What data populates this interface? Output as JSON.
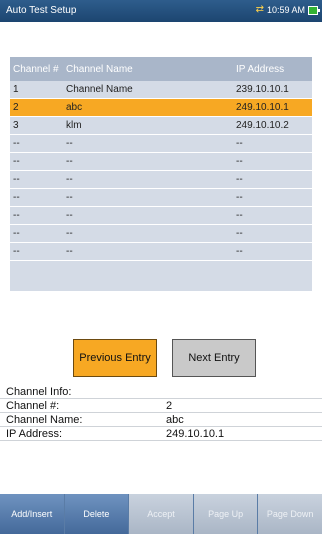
{
  "titlebar": {
    "title": "Auto Test Setup",
    "time": "10:59 AM",
    "icons": [
      "sync-icon",
      "battery-icon"
    ]
  },
  "table": {
    "headers": [
      "Channel #",
      "Channel Name",
      "IP Address"
    ],
    "rows": [
      {
        "channel": "1",
        "name": "Channel Name",
        "ip": "239.10.10.1"
      },
      {
        "channel": "2",
        "name": "abc",
        "ip": "249.10.10.1"
      },
      {
        "channel": "3",
        "name": "klm",
        "ip": "249.10.10.2"
      },
      {
        "channel": "--",
        "name": "--",
        "ip": "--"
      },
      {
        "channel": "--",
        "name": "--",
        "ip": "--"
      },
      {
        "channel": "--",
        "name": "--",
        "ip": "--"
      },
      {
        "channel": "--",
        "name": "--",
        "ip": "--"
      },
      {
        "channel": "--",
        "name": "--",
        "ip": "--"
      },
      {
        "channel": "--",
        "name": "--",
        "ip": "--"
      },
      {
        "channel": "--",
        "name": "--",
        "ip": "--"
      }
    ],
    "selected_row": 2
  },
  "nav": {
    "previous_label": "Previous Entry",
    "next_label": "Next Entry"
  },
  "channel_info": {
    "header": "Channel Info:",
    "channel_label": "Channel #:",
    "channel_value": "2",
    "name_label": "Channel Name:",
    "name_value": "abc",
    "ip_label": "IP Address:",
    "ip_value": "249.10.10.1"
  },
  "footer": {
    "buttons": [
      "Add/Insert",
      "Delete",
      "Accept",
      "Page Up",
      "Page Down"
    ]
  },
  "colors": {
    "accent": "#f7a823",
    "title_bar": "#1c4570",
    "grid_bg": "#d4dbe6"
  }
}
